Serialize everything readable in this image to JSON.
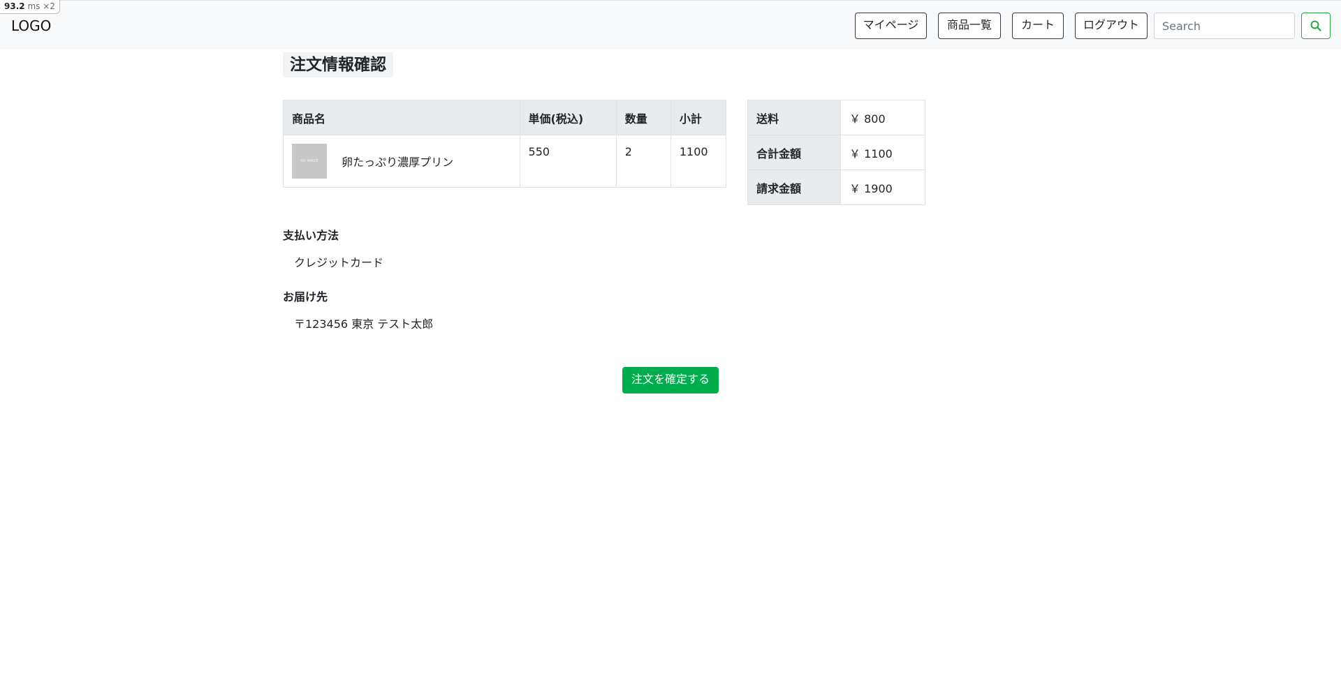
{
  "perf_badge": {
    "value": "93.2",
    "unit": "ms",
    "multiplier": "×2"
  },
  "navbar": {
    "logo": "LOGO",
    "links": [
      {
        "label": "マイページ"
      },
      {
        "label": "商品一覧"
      },
      {
        "label": "カート"
      },
      {
        "label": "ログアウト"
      }
    ],
    "search": {
      "placeholder": "Search",
      "value": ""
    }
  },
  "page": {
    "title": "注文情報確認"
  },
  "items_table": {
    "headers": [
      "商品名",
      "単価(税込)",
      "数量",
      "小計"
    ],
    "rows": [
      {
        "image_text": "NO IMAGE",
        "name": "卵たっぷり濃厚プリン",
        "unit_price": "550",
        "quantity": "2",
        "subtotal": "1100"
      }
    ]
  },
  "summary": {
    "rows": [
      {
        "label": "送料",
        "value": "￥ 800"
      },
      {
        "label": "合計金額",
        "value": "￥ 1100"
      },
      {
        "label": "請求金額",
        "value": "￥ 1900"
      }
    ]
  },
  "payment": {
    "label": "支払い方法",
    "value": "クレジットカード"
  },
  "delivery": {
    "label": "お届け先",
    "value": "〒123456 東京 テスト太郎"
  },
  "actions": {
    "confirm_label": "注文を確定する"
  },
  "colors": {
    "primary_green": "#00ad4c",
    "outline_green": "#28a745",
    "navbar_bg": "#f8f9fa"
  }
}
